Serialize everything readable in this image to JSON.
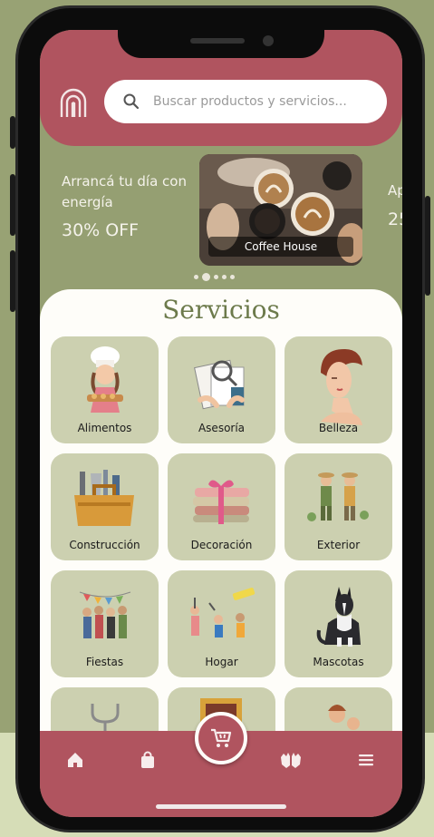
{
  "search": {
    "placeholder": "Buscar productos y servicios..."
  },
  "promo": {
    "title": "Arrancá tu día con energía",
    "discount": "30% OFF",
    "card_label": "Coffee House",
    "next_title_peek": "Ap",
    "next_discount_peek": "25"
  },
  "carousel": {
    "count": 5,
    "active_index": 1
  },
  "services": {
    "title": "Servicios",
    "items": [
      {
        "label": "Alimentos",
        "icon": "chef-icon"
      },
      {
        "label": "Asesoría",
        "icon": "documents-icon"
      },
      {
        "label": "Belleza",
        "icon": "woman-portrait-icon"
      },
      {
        "label": "Construcción",
        "icon": "toolbox-icon"
      },
      {
        "label": "Decoración",
        "icon": "fabric-stack-icon"
      },
      {
        "label": "Exterior",
        "icon": "gardeners-icon"
      },
      {
        "label": "Fiestas",
        "icon": "party-people-icon"
      },
      {
        "label": "Hogar",
        "icon": "cleaning-icon"
      },
      {
        "label": "Mascotas",
        "icon": "dog-icon"
      },
      {
        "label": "",
        "icon": "stethoscope-icon"
      },
      {
        "label": "",
        "icon": "frame-icon"
      },
      {
        "label": "",
        "icon": "family-icon"
      }
    ]
  },
  "nav": {
    "items": [
      "home-icon",
      "shopping-bag-icon",
      "cart-icon",
      "hands-icon",
      "menu-icon"
    ]
  },
  "colors": {
    "primary": "#b0545f",
    "olive": "#959f72",
    "tile": "#ccd0b0",
    "title": "#6c7a4b"
  }
}
